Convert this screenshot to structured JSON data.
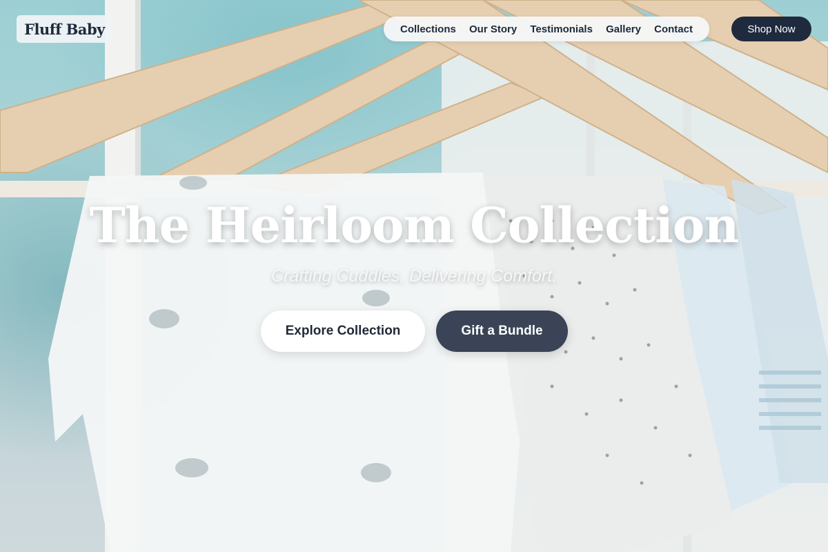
{
  "brand": {
    "name": "Fluff Baby"
  },
  "nav": {
    "items": [
      {
        "label": "Collections"
      },
      {
        "label": "Our Story"
      },
      {
        "label": "Testimonials"
      },
      {
        "label": "Gallery"
      },
      {
        "label": "Contact"
      }
    ],
    "cta_label": "Shop Now"
  },
  "hero": {
    "title": "The Heirloom Collection",
    "subtitle": "Crafting Cuddles, Delivering Comfort.",
    "primary_button": "Explore Collection",
    "secondary_button": "Gift a Bundle",
    "background_image": "baby-clothes-on-wooden-hangers"
  },
  "colors": {
    "navy": "#1f2a3e",
    "slate_button": "#3a4456",
    "white": "#ffffff",
    "background_teal": "#9fc3c9"
  }
}
